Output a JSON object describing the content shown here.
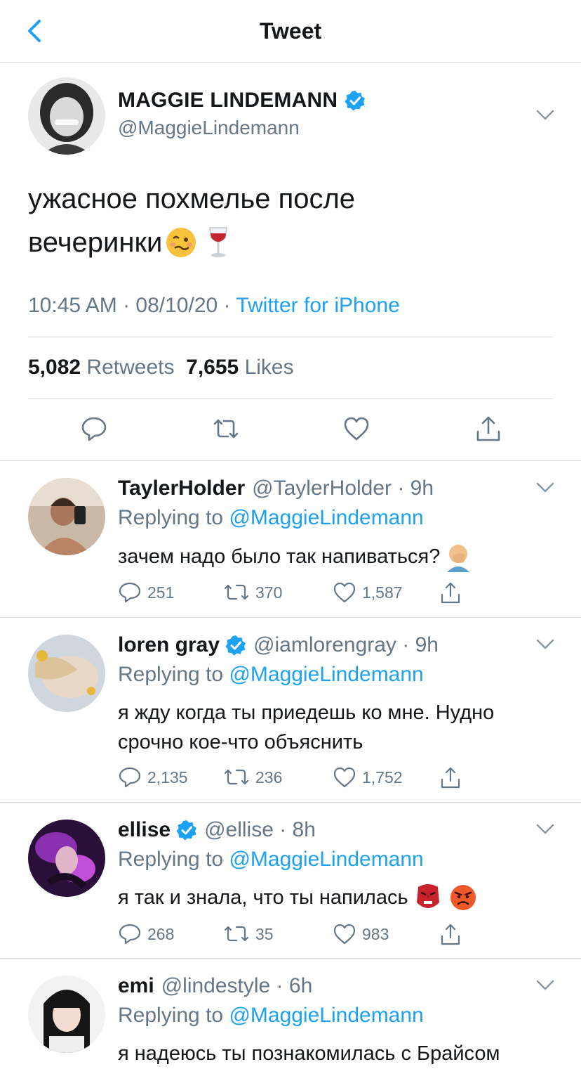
{
  "header": {
    "title": "Tweet"
  },
  "tweet": {
    "name": "MAGGIE LINDEMANN",
    "handle": "@MaggieLindemann",
    "text_line1": "ужасное похмелье после",
    "text_line2": "вечеринки",
    "time": "10:45 AM · 08/10/20 · ",
    "source": "Twitter for iPhone",
    "retweets_count": "5,082",
    "retweets_label": "Retweets",
    "likes_count": "7,655",
    "likes_label": "Likes"
  },
  "replies": [
    {
      "name": "TaylerHolder",
      "handle": "@TaylerHolder · 9h",
      "replying_prefix": "Replying to ",
      "replying_to": "@MaggieLindemann",
      "text": "зачем надо было так напиваться?",
      "replies": "251",
      "retweets": "370",
      "likes": "1,587"
    },
    {
      "name": "loren gray",
      "handle": "@iamlorengray · 9h",
      "replying_prefix": "Replying to ",
      "replying_to": "@MaggieLindemann",
      "text": "я жду когда ты приедешь ко мне. Нудно срочно кое-что объяснить",
      "replies": "2,135",
      "retweets": "236",
      "likes": "1,752"
    },
    {
      "name": "ellise",
      "handle": "@ellise · 8h",
      "replying_prefix": "Replying to ",
      "replying_to": "@MaggieLindemann",
      "text": "я так и знала, что ты напилась",
      "replies": "268",
      "retweets": "35",
      "likes": "983"
    },
    {
      "name": "emi",
      "handle": "@lindestyle · 6h",
      "replying_prefix": "Replying to ",
      "replying_to": "@MaggieLindemann",
      "text": "я надеюсь ты познакомилась с Брайсом"
    }
  ],
  "colors": {
    "accent": "#1da1f2",
    "muted": "#657786",
    "text": "#14171a",
    "border": "#d8dde1"
  }
}
